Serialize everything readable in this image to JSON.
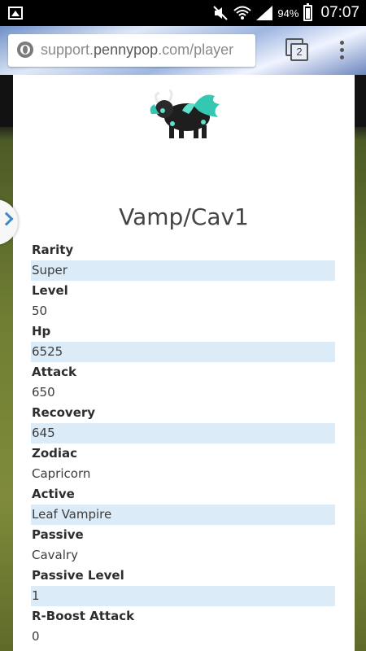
{
  "status_bar": {
    "battery_pct": "94%",
    "time": "07:07",
    "icons": [
      "image-icon",
      "mute-icon",
      "wifi-icon",
      "signal-icon",
      "battery-icon"
    ]
  },
  "browser": {
    "url_prefix": "support.",
    "url_host": "pennypop",
    "url_suffix": ".com/player",
    "tab_count": "2"
  },
  "card": {
    "title": "Vamp/Cav1",
    "stats": [
      {
        "label": "Rarity",
        "value": "Super"
      },
      {
        "label": "Level",
        "value": "50"
      },
      {
        "label": "Hp",
        "value": "6525"
      },
      {
        "label": "Attack",
        "value": "650"
      },
      {
        "label": "Recovery",
        "value": "645"
      },
      {
        "label": "Zodiac",
        "value": "Capricorn"
      },
      {
        "label": "Active",
        "value": "Leaf Vampire"
      },
      {
        "label": "Passive",
        "value": "Cavalry"
      },
      {
        "label": "Passive Level",
        "value": "1"
      },
      {
        "label": "R-Boost Attack",
        "value": "0"
      }
    ]
  },
  "colors": {
    "row_highlight": "#dbebf7",
    "accent": "#3d89c7"
  }
}
